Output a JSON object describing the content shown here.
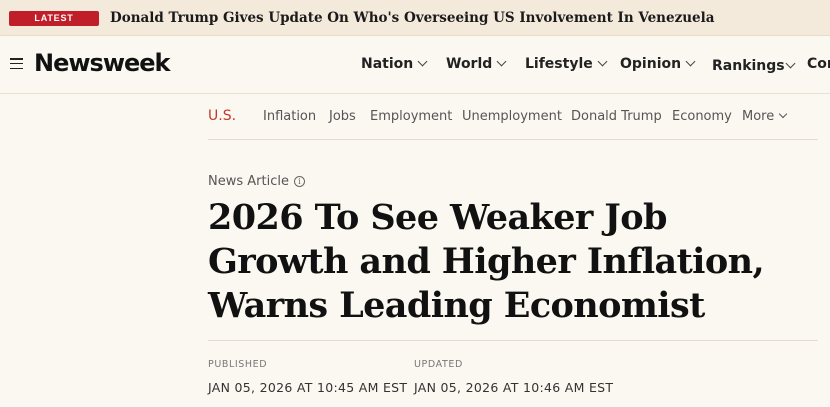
{
  "ticker": {
    "badge": "LATEST",
    "headline": "Donald Trump Gives Update On Who's Overseeing US Involvement In Venezuela"
  },
  "header": {
    "logo": "Newsweek",
    "nav": [
      {
        "label": "Nation"
      },
      {
        "label": "World"
      },
      {
        "label": "Lifestyle"
      },
      {
        "label": "Opinion"
      },
      {
        "label": "Rankings"
      },
      {
        "label": "Con"
      }
    ]
  },
  "subnav": {
    "section": "U.S.",
    "items": [
      "Inflation",
      "Jobs",
      "Employment",
      "Unemployment",
      "Donald Trump",
      "Economy"
    ],
    "more": "More"
  },
  "article": {
    "type": "News Article",
    "headline": "2026 To See Weaker Job Growth and Higher Inflation, Warns Leading Economist",
    "published_label": "PUBLISHED",
    "published_value": "JAN 05, 2026 AT 10:45 AM EST",
    "updated_label": "UPDATED",
    "updated_value": "JAN 05, 2026 AT 10:46 AM EST"
  },
  "colors": {
    "accent_red": "#c01f2a",
    "background": "#fbf8f1"
  }
}
